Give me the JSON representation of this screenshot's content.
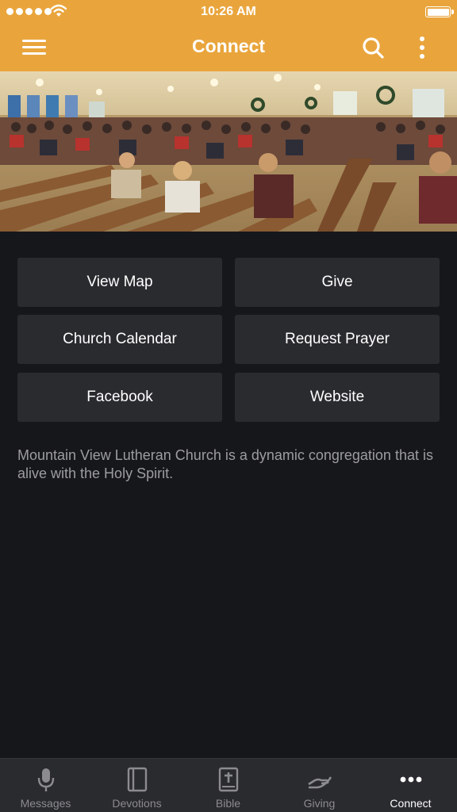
{
  "status_bar": {
    "time": "10:26 AM"
  },
  "header": {
    "title": "Connect"
  },
  "hero": {
    "alt": ""
  },
  "buttons": [
    {
      "label": "View Map"
    },
    {
      "label": "Give"
    },
    {
      "label": "Church Calendar"
    },
    {
      "label": "Request Prayer"
    },
    {
      "label": "Facebook"
    },
    {
      "label": "Website"
    }
  ],
  "description": "Mountain View Lutheran Church is a dynamic congregation that is alive with the Holy Spirit.",
  "tabs": [
    {
      "label": "Messages",
      "icon": "microphone-icon"
    },
    {
      "label": "Devotions",
      "icon": "book-icon"
    },
    {
      "label": "Bible",
      "icon": "bible-icon"
    },
    {
      "label": "Giving",
      "icon": "giving-hand-icon"
    },
    {
      "label": "Connect",
      "icon": "more-dots-icon",
      "active": true
    }
  ],
  "colors": {
    "brand": "#e9a53c",
    "background": "#16171b",
    "button": "#2a2b2f"
  }
}
